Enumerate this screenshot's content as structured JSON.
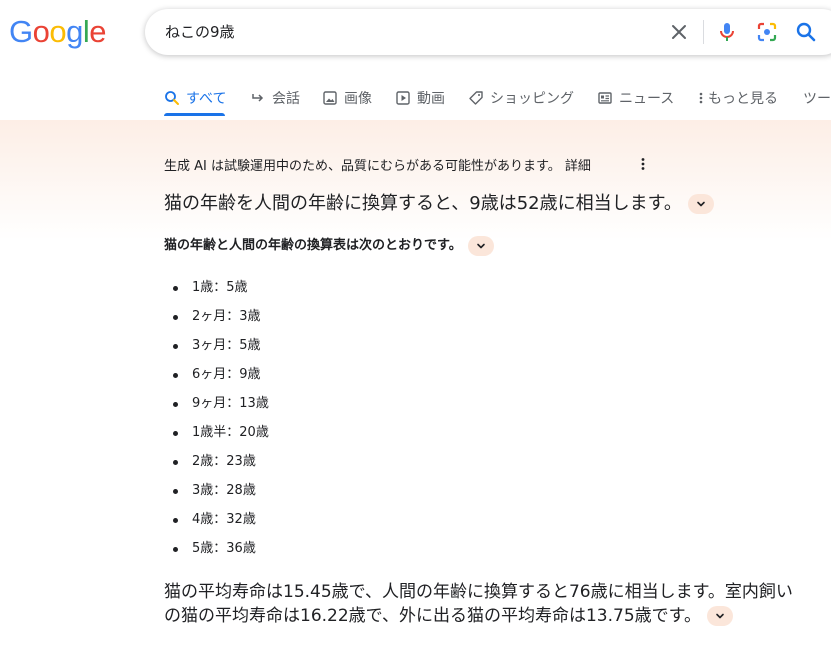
{
  "logo": "Google",
  "search": {
    "query": "ねこの9歳"
  },
  "tabs": [
    {
      "label": "すべて",
      "icon": "search-icon",
      "active": true
    },
    {
      "label": "会話",
      "icon": "arrow-reply-icon"
    },
    {
      "label": "画像",
      "icon": "image-icon"
    },
    {
      "label": "動画",
      "icon": "play-icon"
    },
    {
      "label": "ショッピング",
      "icon": "tag-icon"
    },
    {
      "label": "ニュース",
      "icon": "newspaper-icon"
    },
    {
      "label": "もっと見る",
      "icon": "more-vert-icon"
    },
    {
      "label": "ツー",
      "icon": ""
    }
  ],
  "ai_overview": {
    "notice": "生成 AI は試験運用中のため、品質にむらがある可能性があります。 詳細",
    "headline": "猫の年齢を人間の年齢に換算すると、9歳は52歳に相当します。",
    "subhead": "猫の年齢と人間の年齢の換算表は次のとおりです。",
    "items": [
      "1歳：5歳",
      "2ヶ月：3歳",
      "3ヶ月：5歳",
      "6ヶ月：9歳",
      "9ヶ月：13歳",
      "1歳半：20歳",
      "2歳：23歳",
      "3歳：28歳",
      "4歳：32歳",
      "5歳：36歳"
    ],
    "paragraph": "猫の平均寿命は15.45歳で、人間の年齢に換算すると76歳に相当します。室内飼いの猫の平均寿命は16.22歳で、外に出る猫の平均寿命は13.75歳です。"
  },
  "colors": {
    "accent": "#1a73e8",
    "text": "#202124",
    "muted": "#5f6368",
    "chip": "#fbe6da"
  }
}
